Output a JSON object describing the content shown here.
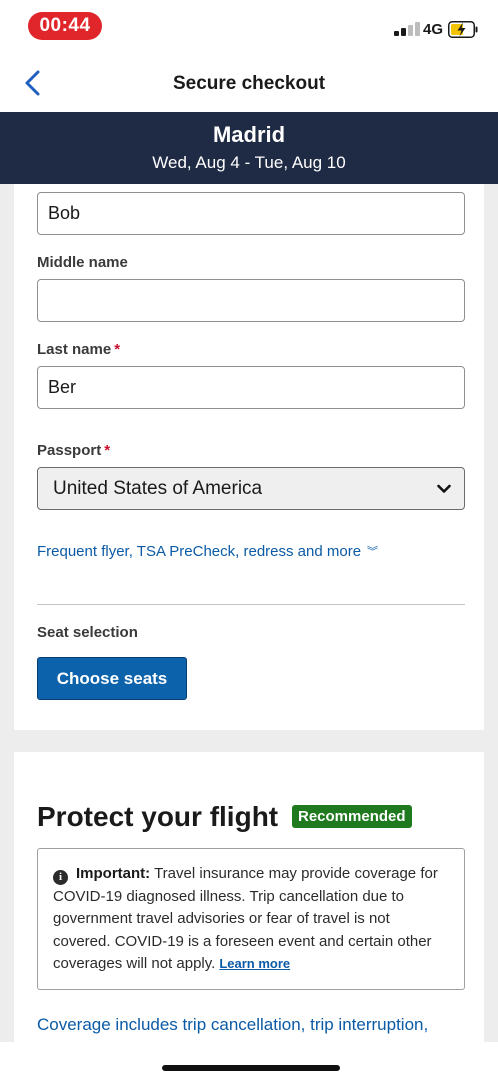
{
  "status_bar": {
    "time": "00:44",
    "network": "4G",
    "icons": [
      "signal-icon",
      "battery-charging-icon"
    ]
  },
  "nav": {
    "title": "Secure checkout",
    "back_icon": "chevron-left-icon"
  },
  "trip": {
    "city": "Madrid",
    "dates": "Wed, Aug 4 - Tue, Aug 10"
  },
  "traveler_form": {
    "first_name": {
      "value": "Bob"
    },
    "middle_name": {
      "label": "Middle name",
      "value": ""
    },
    "last_name": {
      "label": "Last name",
      "required_mark": "*",
      "value": "Ber"
    },
    "passport": {
      "label": "Passport",
      "required_mark": "*",
      "selected": "United States of America"
    },
    "more_link": "Frequent flyer, TSA PreCheck, redress and more",
    "seat_selection": {
      "label": "Seat selection",
      "button": "Choose seats"
    }
  },
  "protect": {
    "title": "Protect your flight",
    "badge": "Recommended",
    "notice": {
      "bold": "Important:",
      "text": "Travel insurance may provide coverage for COVID-19 diagnosed illness. Trip cancellation due to government travel advisories or fear of travel is not covered. COVID-19 is a foreseen event and certain other coverages will not apply.",
      "link": "Learn more"
    },
    "coverage_text": "Coverage includes trip cancellation, trip interruption,"
  },
  "colors": {
    "header_bg": "#1f2a44",
    "primary_button": "#0d63ab",
    "link": "#0b5aa6",
    "badge": "#1f7a1f",
    "required": "#c8102e",
    "time_pill": "#e0262b"
  }
}
